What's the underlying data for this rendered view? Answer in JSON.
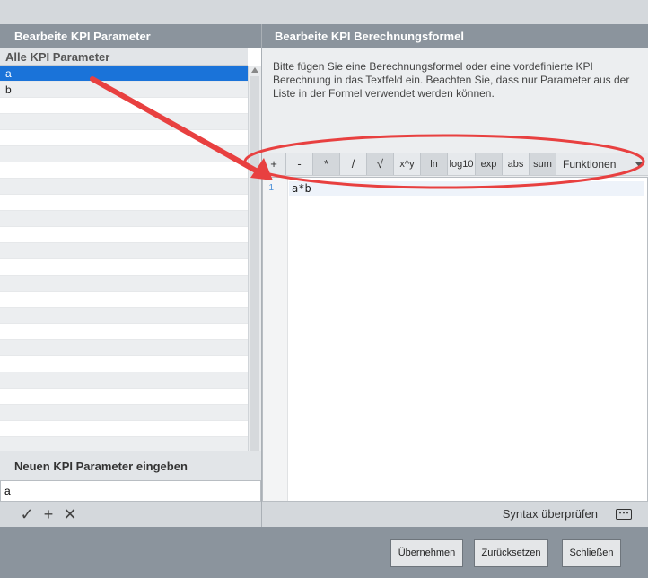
{
  "left": {
    "title": "Bearbeite KPI Parameter",
    "list_header": "Alle KPI Parameter",
    "items": [
      "a",
      "b"
    ],
    "new_param_label": "Neuen KPI Parameter eingeben",
    "new_param_value": "a"
  },
  "right": {
    "title": "Bearbeite KPI Berechnungsformel",
    "hint": "Bitte fügen Sie eine Berechnungsformel oder eine vordefinierte KPI Berechnung in das Textfeld ein. Beachten Sie, dass nur Parameter aus der Liste in der Formel verwendet werden können.",
    "toolbar": {
      "plus": "+",
      "minus": "-",
      "times": "*",
      "divide": "/",
      "sqrt": "√",
      "power": "x^y",
      "ln": "ln",
      "log10": "log10",
      "exp": "exp",
      "abs": "abs",
      "sum": "sum",
      "functions": "Funktionen"
    },
    "editor": {
      "line_number": "1",
      "formula": "a*b"
    },
    "syntax_check": "Syntax überprüfen",
    "more_icon": "⋯"
  },
  "footer": {
    "apply": "Übernehmen",
    "reset": "Zurücksetzen",
    "close": "Schließen"
  },
  "icons": {
    "check": "✓",
    "add": "+",
    "remove": "✕"
  },
  "colors": {
    "header": "#8b949d",
    "selection": "#1a73d9",
    "annotation": "#e84040"
  }
}
